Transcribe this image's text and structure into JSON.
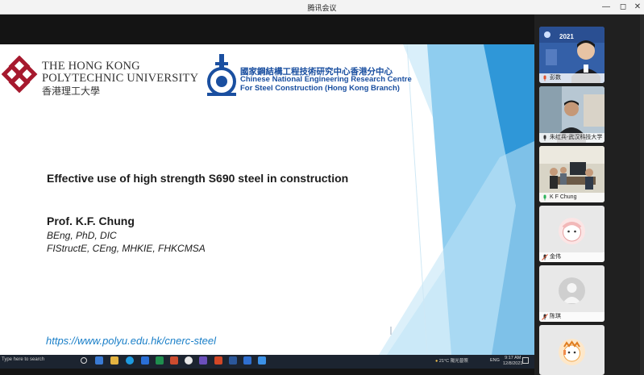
{
  "window": {
    "title": "腾讯会议",
    "controls": [
      "minimize-icon",
      "maximize-icon",
      "close-icon"
    ]
  },
  "slide": {
    "polyu_logo": {
      "line1": "THE HONG KONG",
      "line2": "POLYTECHNIC UNIVERSITY",
      "line3": "香港理工大學"
    },
    "cnerc_logo": {
      "line1": "國家鋼結構工程技術研究中心香港分中心",
      "line2": "Chinese National Engineering Research Centre",
      "line3": "For Steel Construction (Hong Kong Branch)"
    },
    "title": "Effective use of high strength S690 steel in construction",
    "speaker": "Prof. K.F. Chung",
    "credentials_line1": "BEng, PhD, DIC",
    "credentials_line2": "FIStructE, CEng, MHKIE, FHKCMSA",
    "url": "https://www.polyu.edu.hk/cnerc-steel",
    "colors": {
      "accent_blue": "#2f97d8",
      "light_blue": "#bfe3f6",
      "polyu_red": "#a6192e",
      "cnerc_blue": "#1a4fa0"
    }
  },
  "participants": [
    {
      "name": "彭数",
      "type": "video",
      "banner_text": "2021"
    },
    {
      "name": "朱红兵-武汉科技大学",
      "type": "video"
    },
    {
      "name": "K F Chung",
      "type": "video"
    },
    {
      "name": "金伟",
      "type": "avatar"
    },
    {
      "name": "陈琪",
      "type": "avatar"
    },
    {
      "name": "",
      "type": "avatar"
    }
  ],
  "taskbar": {
    "search_placeholder": "Type here to search",
    "weather": "21°C",
    "weather_desc": "陽光普照",
    "lang": "ENG",
    "time": "9:17 AM",
    "date": "12/8/2021"
  }
}
